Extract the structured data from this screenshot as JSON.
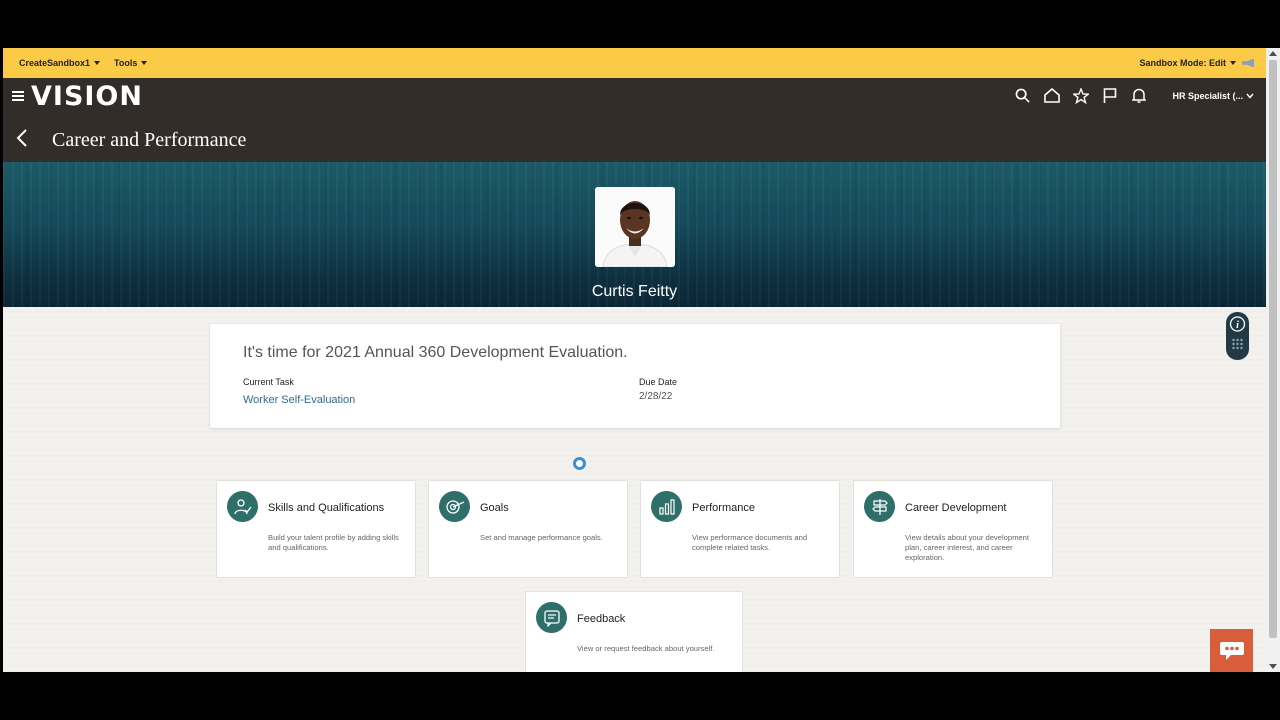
{
  "sandbox_bar": {
    "sandbox_menu": "CreateSandbox1",
    "tools_menu": "Tools",
    "mode": "Sandbox Mode: Edit"
  },
  "header": {
    "logo": "VISION",
    "user_menu": "HR Specialist (...",
    "page_title": "Career and Performance",
    "icons": [
      "menu-icon",
      "search-icon",
      "home-icon",
      "star-icon",
      "flag-icon",
      "bell-icon",
      "chevron-down-icon",
      "back-icon"
    ]
  },
  "profile": {
    "name": "Curtis Feitty"
  },
  "evaluation": {
    "title": "It's time for 2021 Annual 360 Development Evaluation.",
    "current_task_label": "Current Task",
    "current_task": "Worker Self-Evaluation",
    "due_date_label": "Due Date",
    "due_date": "2/28/22"
  },
  "tiles": [
    {
      "title": "Skills and Qualifications",
      "description": "Build your talent profile by adding skills and qualifications.",
      "icon": "skills-icon"
    },
    {
      "title": "Goals",
      "description": "Set and manage performance goals.",
      "icon": "goals-icon"
    },
    {
      "title": "Performance",
      "description": "View performance documents and complete related tasks.",
      "icon": "performance-chart-icon"
    },
    {
      "title": "Career Development",
      "description": "View details about your development plan, career interest, and career exploration.",
      "icon": "signpost-icon"
    },
    {
      "title": "Feedback",
      "description": "View or request feedback about yourself.",
      "icon": "feedback-icon"
    }
  ],
  "colors": {
    "sandbox_bar": "#fbcb48",
    "header": "#332d29",
    "tile_icon": "#2f6f6a",
    "link": "#2a6d8f",
    "chat_button": "#d95d3b"
  }
}
